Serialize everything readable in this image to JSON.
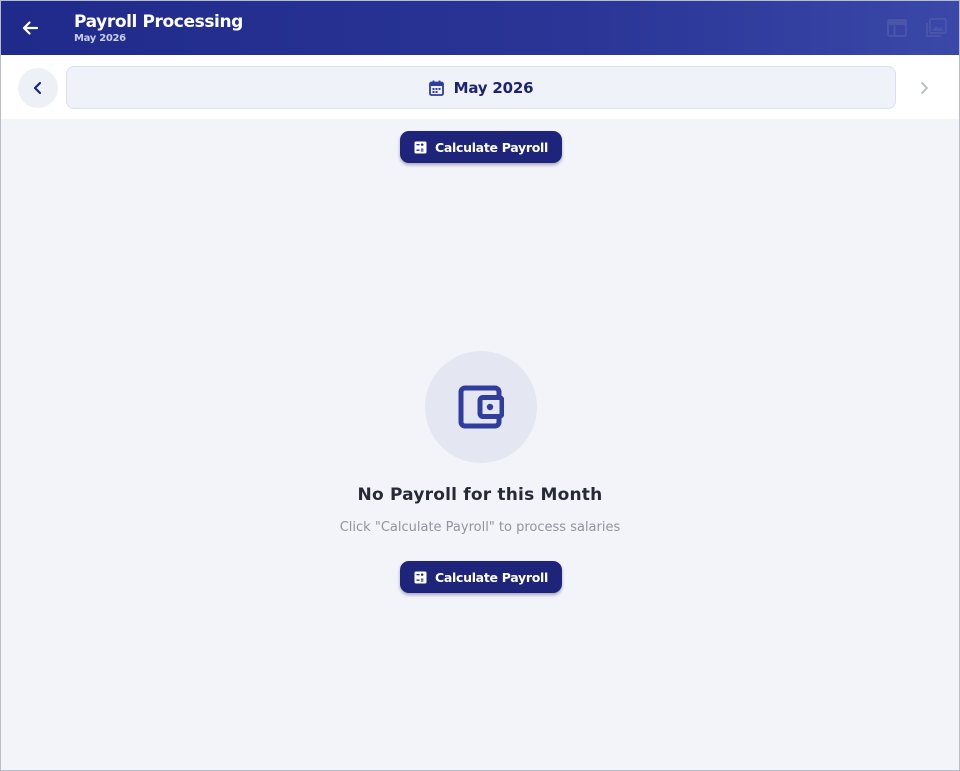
{
  "header": {
    "title": "Payroll Processing",
    "subtitle": "May 2026",
    "icons": [
      "back-arrow-icon",
      "table-view-icon",
      "gallery-icon"
    ]
  },
  "month_selector": {
    "label": "May 2026",
    "icons": [
      "chevron-left-icon",
      "calendar-icon",
      "chevron-right-icon"
    ]
  },
  "toolbar": {
    "calculate_label": "Calculate Payroll"
  },
  "empty_state": {
    "icon": "wallet-icon",
    "title": "No Payroll for this Month",
    "message": "Click \"Calculate Payroll\" to process salaries",
    "button_label": "Calculate Payroll"
  },
  "colors": {
    "primary": "#1e2479",
    "appbar": "#2a3596",
    "background": "#f3f4f9",
    "icon_accent": "#2f3d9e"
  }
}
